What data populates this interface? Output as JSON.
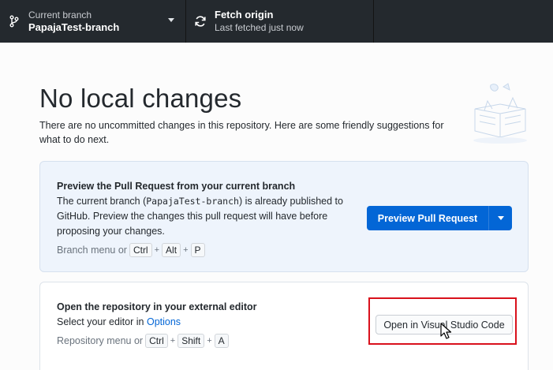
{
  "toolbar": {
    "branch": {
      "title": "Current branch",
      "name": "PapajaTest-branch"
    },
    "fetch": {
      "title": "Fetch origin",
      "subtitle": "Last fetched just now"
    }
  },
  "main": {
    "heading": "No local changes",
    "description": "There are no uncommitted changes in this repository. Here are some friendly suggestions for what to do next."
  },
  "pull_request_card": {
    "title": "Preview the Pull Request from your current branch",
    "body_before": "The current branch (",
    "branch_name": "PapajaTest-branch",
    "body_after": ") is already published to GitHub. Preview the changes this pull request will have before proposing your changes.",
    "hint_prefix": "Branch menu or",
    "keys": [
      "Ctrl",
      "Alt",
      "P"
    ],
    "button_label": "Preview Pull Request"
  },
  "editor_card": {
    "title": "Open the repository in your external editor",
    "body_prefix": "Select your editor in",
    "options_link": "Options",
    "hint_prefix": "Repository menu or",
    "keys": [
      "Ctrl",
      "Shift",
      "A"
    ],
    "button_label": "Open in Visual Studio Code"
  },
  "colors": {
    "toolbar_bg": "#24292e",
    "primary": "#0366d6",
    "highlight": "#d9111c"
  }
}
